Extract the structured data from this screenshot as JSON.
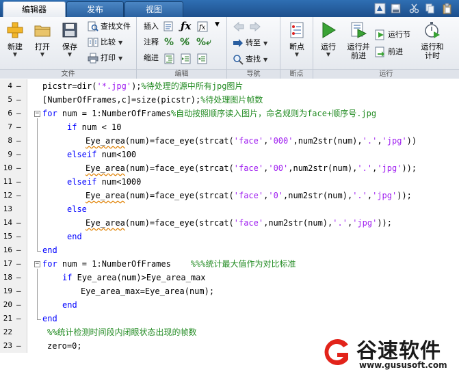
{
  "tabs": [
    {
      "label": "编辑器",
      "active": true
    },
    {
      "label": "发布",
      "active": false
    },
    {
      "label": "视图",
      "active": false
    }
  ],
  "ribbon": {
    "file": {
      "title": "文件",
      "new_label": "新建",
      "open_label": "打开",
      "save_label": "保存",
      "find_files_label": "查找文件",
      "compare_label": "比较",
      "print_label": "打印"
    },
    "edit": {
      "title": "编辑",
      "insert_label": "插入",
      "comment_label": "注释",
      "indent_label": "缩进"
    },
    "navigate": {
      "title": "导航",
      "goto_label": "转至",
      "find_label": "查找"
    },
    "breakpoints": {
      "title": "断点",
      "breakpoints_label": "断点"
    },
    "run": {
      "title": "运行",
      "run_label": "运行",
      "run_advance_label": "运行并\n前进",
      "run_section_label": "运行节",
      "advance_label": "前进",
      "run_time_label": "运行和\n计时"
    }
  },
  "code_lines": [
    {
      "n": "4",
      "dash": "—",
      "indent": 62,
      "parts": [
        {
          "t": "picstr=dir("
        },
        {
          "t": "'*.jpg'",
          "c": "str"
        },
        {
          "t": ");"
        },
        {
          "t": "%待处理的源中所有jpg图片",
          "c": "cm"
        }
      ]
    },
    {
      "n": "5",
      "dash": "—",
      "indent": 62,
      "parts": [
        {
          "t": "[NumberOfFrames,c]=size(picstr);"
        },
        {
          "t": "%待处理图片帧数",
          "c": "cm"
        }
      ]
    },
    {
      "n": "6",
      "dash": "—",
      "indent": 62,
      "parts": [
        {
          "t": "for",
          "c": "kw"
        },
        {
          "t": " num = 1:NumberOfFrames"
        },
        {
          "t": "%自动按照顺序读入图片，命名规则为face+顺序号.jpg",
          "c": "cm"
        }
      ]
    },
    {
      "n": "7",
      "dash": "—",
      "indent": 98,
      "parts": [
        {
          "t": "if",
          "c": "kw"
        },
        {
          "t": " num < 10"
        }
      ]
    },
    {
      "n": "8",
      "dash": "—",
      "indent": 125,
      "parts": [
        {
          "t": "Eye_area",
          "c": "warn"
        },
        {
          "t": "(num)=face_eye(strcat("
        },
        {
          "t": "'face'",
          "c": "str"
        },
        {
          "t": ","
        },
        {
          "t": "'000'",
          "c": "str"
        },
        {
          "t": ",num2str(num),"
        },
        {
          "t": "'.'",
          "c": "str"
        },
        {
          "t": ","
        },
        {
          "t": "'jpg'",
          "c": "str"
        },
        {
          "t": "))"
        }
      ]
    },
    {
      "n": "9",
      "dash": "—",
      "indent": 98,
      "parts": [
        {
          "t": "elseif",
          "c": "kw"
        },
        {
          "t": " num<100"
        }
      ]
    },
    {
      "n": "10",
      "dash": "—",
      "indent": 125,
      "parts": [
        {
          "t": "Eye_area",
          "c": "warn"
        },
        {
          "t": "(num)=face_eye(strcat("
        },
        {
          "t": "'face'",
          "c": "str"
        },
        {
          "t": ","
        },
        {
          "t": "'00'",
          "c": "str"
        },
        {
          "t": ",num2str(num),"
        },
        {
          "t": "'.'",
          "c": "str"
        },
        {
          "t": ","
        },
        {
          "t": "'jpg'",
          "c": "str"
        },
        {
          "t": "));"
        }
      ]
    },
    {
      "n": "11",
      "dash": "—",
      "indent": 98,
      "parts": [
        {
          "t": "elseif",
          "c": "kw"
        },
        {
          "t": " num<1000"
        }
      ]
    },
    {
      "n": "12",
      "dash": "—",
      "indent": 125,
      "parts": [
        {
          "t": "Eye_area",
          "c": "warn"
        },
        {
          "t": "(num)=face_eye(strcat("
        },
        {
          "t": "'face'",
          "c": "str"
        },
        {
          "t": ","
        },
        {
          "t": "'0'",
          "c": "str"
        },
        {
          "t": ",num2str(num),"
        },
        {
          "t": "'.'",
          "c": "str"
        },
        {
          "t": ","
        },
        {
          "t": "'jpg'",
          "c": "str"
        },
        {
          "t": "));"
        }
      ]
    },
    {
      "n": "13",
      "dash": "",
      "indent": 98,
      "parts": [
        {
          "t": "else",
          "c": "kw"
        }
      ]
    },
    {
      "n": "14",
      "dash": "—",
      "indent": 125,
      "parts": [
        {
          "t": "Eye_area",
          "c": "warn"
        },
        {
          "t": "(num)=face_eye(strcat("
        },
        {
          "t": "'face'",
          "c": "str"
        },
        {
          "t": ",num2str(num),"
        },
        {
          "t": "'.'",
          "c": "str"
        },
        {
          "t": ","
        },
        {
          "t": "'jpg'",
          "c": "str"
        },
        {
          "t": "));"
        }
      ]
    },
    {
      "n": "15",
      "dash": "—",
      "indent": 98,
      "parts": [
        {
          "t": "end",
          "c": "kw"
        }
      ]
    },
    {
      "n": "16",
      "dash": "—",
      "indent": 62,
      "parts": [
        {
          "t": "end",
          "c": "kw"
        }
      ]
    },
    {
      "n": "17",
      "dash": "—",
      "indent": 62,
      "parts": [
        {
          "t": "for",
          "c": "kw"
        },
        {
          "t": " num = 1:NumberOfFrames    "
        },
        {
          "t": "%%%统计最大值作为对比标准",
          "c": "cm"
        }
      ]
    },
    {
      "n": "18",
      "dash": "—",
      "indent": 91,
      "parts": [
        {
          "t": "if",
          "c": "kw"
        },
        {
          "t": " Eye_area(num)>Eye_area_max"
        }
      ]
    },
    {
      "n": "19",
      "dash": "—",
      "indent": 118,
      "parts": [
        {
          "t": "Eye_area_max=Eye_area(num);"
        }
      ]
    },
    {
      "n": "20",
      "dash": "—",
      "indent": 91,
      "parts": [
        {
          "t": "end",
          "c": "kw"
        }
      ]
    },
    {
      "n": "21",
      "dash": "—",
      "indent": 62,
      "parts": [
        {
          "t": "end",
          "c": "kw"
        }
      ]
    },
    {
      "n": "22",
      "dash": "",
      "indent": 69,
      "parts": [
        {
          "t": "%%统计检测时间段内闭眼状态出现的帧数",
          "c": "cm"
        }
      ]
    },
    {
      "n": "23",
      "dash": "—",
      "indent": 69,
      "parts": [
        {
          "t": "zero=0;"
        }
      ]
    }
  ],
  "watermark": {
    "brand": "谷速软件",
    "url": "www.gususoft.com"
  },
  "colors": {
    "keyword": "#0000ff",
    "string": "#a020f0",
    "comment": "#228b22",
    "tab_bar": "#1d4f8c"
  }
}
